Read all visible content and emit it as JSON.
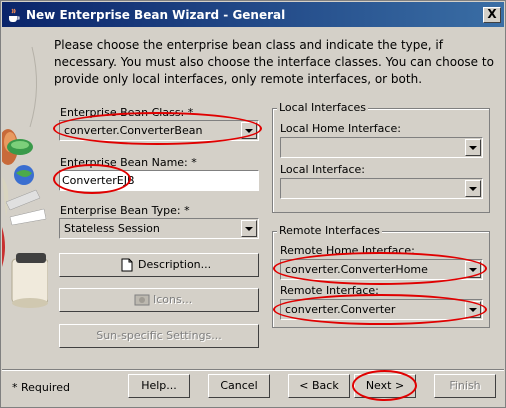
{
  "window": {
    "title": "New Enterprise Bean Wizard - General",
    "close_label": "X"
  },
  "intro_text": "Please choose the enterprise bean class and indicate the type, if necessary. You must also choose the interface classes.  You can choose to provide only local interfaces, only remote interfaces, or both.",
  "left": {
    "class_label": "Enterprise Bean Class: *",
    "class_value": "converter.ConverterBean",
    "name_label": "Enterprise Bean Name: *",
    "name_value": "ConverterEJB",
    "type_label": "Enterprise Bean Type: *",
    "type_value": "Stateless Session",
    "description_button": "Description...",
    "icons_button": "Icons...",
    "sun_button": "Sun-specific Settings..."
  },
  "local": {
    "group_title": "Local Interfaces",
    "home_label": "Local Home Interface:",
    "home_value": "",
    "iface_label": "Local Interface:",
    "iface_value": ""
  },
  "remote": {
    "group_title": "Remote Interfaces",
    "home_label": "Remote Home Interface:",
    "home_value": "converter.ConverterHome",
    "iface_label": "Remote Interface:",
    "iface_value": "converter.Converter"
  },
  "footer": {
    "required_note": "* Required",
    "help": "Help...",
    "cancel": "Cancel",
    "back": "< Back",
    "next": "Next >",
    "finish": "Finish"
  },
  "colors": {
    "titlebar_start": "#0a246a",
    "titlebar_end": "#3a6ea5",
    "highlight_ring": "#e00000",
    "dialog_bg": "#d4d0c8"
  },
  "icons": [
    "java-cup-icon",
    "close-icon",
    "document-icon",
    "picture-icon",
    "dropdown-arrow-icon"
  ]
}
